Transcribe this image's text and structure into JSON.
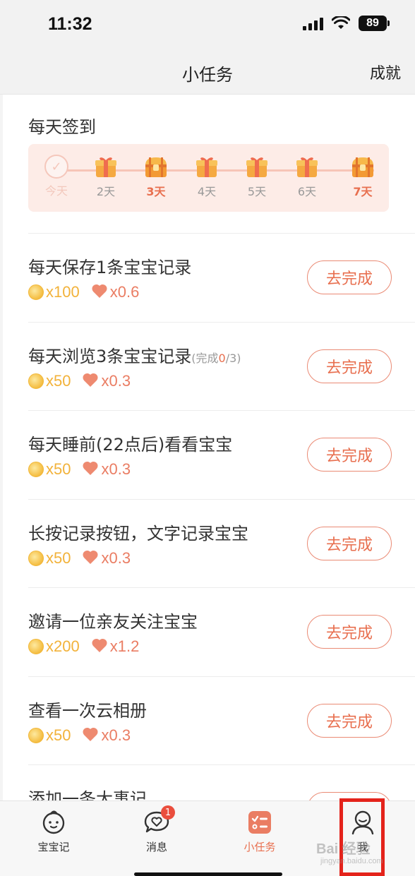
{
  "status_bar": {
    "time": "11:32",
    "battery": "89"
  },
  "nav": {
    "title": "小任务",
    "right_link": "成就"
  },
  "signin": {
    "title": "每天签到",
    "days": [
      {
        "label": "今天",
        "icon": "check-icon",
        "state": "done"
      },
      {
        "label": "2天",
        "icon": "gift-icon",
        "state": "normal"
      },
      {
        "label": "3天",
        "icon": "chest-icon",
        "state": "big"
      },
      {
        "label": "4天",
        "icon": "gift-icon",
        "state": "normal"
      },
      {
        "label": "5天",
        "icon": "gift-icon",
        "state": "normal"
      },
      {
        "label": "6天",
        "icon": "gift-icon",
        "state": "normal"
      },
      {
        "label": "7天",
        "icon": "chest-icon",
        "state": "big"
      }
    ]
  },
  "tasks": [
    {
      "title": "每天保存1条宝宝记录",
      "note": "",
      "coins": "x100",
      "hearts": "x0.6",
      "button": "去完成"
    },
    {
      "title": "每天浏览3条宝宝记录",
      "note_prefix": "(完成",
      "note_value": "0",
      "note_suffix": "/3)",
      "coins": "x50",
      "hearts": "x0.3",
      "button": "去完成"
    },
    {
      "title": "每天睡前(22点后)看看宝宝",
      "coins": "x50",
      "hearts": "x0.3",
      "button": "去完成"
    },
    {
      "title": "长按记录按钮，文字记录宝宝",
      "coins": "x50",
      "hearts": "x0.3",
      "button": "去完成"
    },
    {
      "title": "邀请一位亲友关注宝宝",
      "coins": "x200",
      "hearts": "x1.2",
      "button": "去完成"
    },
    {
      "title": "查看一次云相册",
      "coins": "x50",
      "hearts": "x0.3",
      "button": "去完成"
    },
    {
      "title": "添加一条大事记",
      "button": "去完成"
    }
  ],
  "tabbar": {
    "items": [
      {
        "label": "宝宝记",
        "icon": "baby-face-icon"
      },
      {
        "label": "消息",
        "icon": "chat-heart-icon",
        "badge": "1"
      },
      {
        "label": "小任务",
        "icon": "task-list-icon",
        "active": true
      },
      {
        "label": "我",
        "icon": "person-icon"
      }
    ]
  },
  "watermark": {
    "text": "Bai 经验",
    "sub": "jingyan.baidu.com"
  },
  "colors": {
    "accent": "#e86f4f",
    "coin": "#f2b23a",
    "heart": "#ea7d63",
    "signin_bg": "#fdece7"
  }
}
